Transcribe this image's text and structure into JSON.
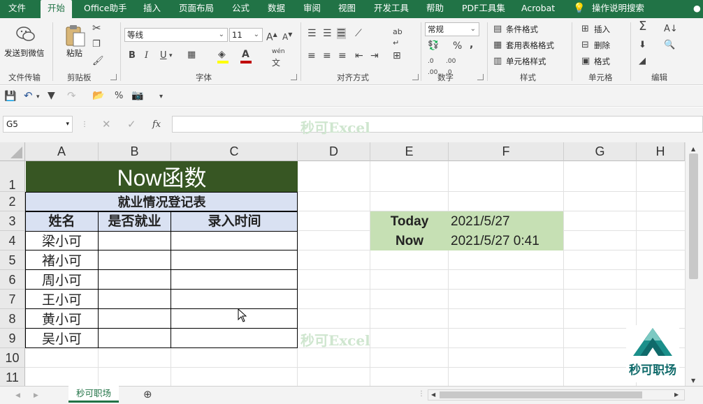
{
  "ribbon_tabs": [
    "文件",
    "开始",
    "Office助手",
    "插入",
    "页面布局",
    "公式",
    "数据",
    "审阅",
    "视图",
    "开发工具",
    "帮助",
    "PDF工具集",
    "Acrobat"
  ],
  "tell_me": "操作说明搜索",
  "ribbon": {
    "wechat": {
      "label": "发送到微信",
      "group": "文件传输"
    },
    "clipboard": {
      "paste": "粘贴",
      "group": "剪贴板"
    },
    "font": {
      "name": "等线",
      "size": "11",
      "bold": "B",
      "italic": "I",
      "underline": "U",
      "group": "字体",
      "wen": "wén",
      "wen_char": "文"
    },
    "alignment": {
      "group": "对齐方式"
    },
    "number": {
      "format": "常规",
      "group": "数字",
      "percent": "%",
      "comma": ","
    },
    "styles": {
      "conditional": "条件格式",
      "table": "套用表格格式",
      "cell": "单元格样式",
      "group": "样式"
    },
    "cells": {
      "insert": "插入",
      "delete": "删除",
      "format": "格式",
      "group": "单元格"
    },
    "editing": {
      "group": "编辑",
      "sum": "Σ"
    }
  },
  "formula_bar": {
    "name_box": "G5",
    "fx": "fx",
    "value": ""
  },
  "watermark": "秒可Excel",
  "columns": [
    "A",
    "B",
    "C",
    "D",
    "E",
    "F",
    "G",
    "H"
  ],
  "rows": [
    "1",
    "2",
    "3",
    "4",
    "5",
    "6",
    "7",
    "8",
    "9",
    "10",
    "11"
  ],
  "sheet": {
    "title": "Now函数",
    "subtitle": "就业情况登记表",
    "headers": [
      "姓名",
      "是否就业",
      "录入时间"
    ],
    "names": [
      "梁小可",
      "褚小可",
      "周小可",
      "王小可",
      "黄小可",
      "吴小可"
    ],
    "today_label": "Today",
    "today_value": "2021/5/27",
    "now_label": "Now",
    "now_value": "2021/5/27 0:41"
  },
  "logo_text": "秒可职场",
  "sheet_tab": "秒可职场",
  "colors": {
    "excel_green": "#217346",
    "title_fill": "#375623",
    "header_fill": "#d9e1f2",
    "info_fill": "#c6e0b4"
  }
}
